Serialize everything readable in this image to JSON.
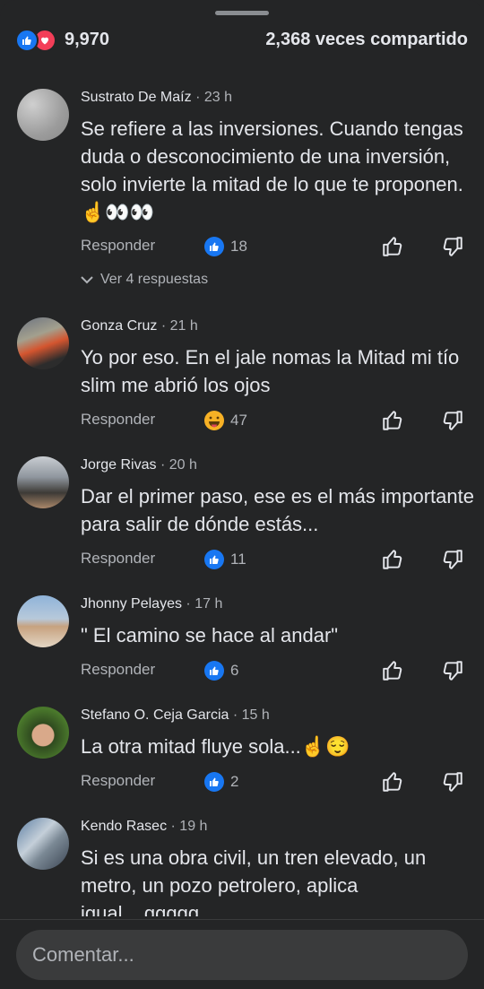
{
  "stats": {
    "reaction_count": "9,970",
    "shares": "2,368 veces compartido"
  },
  "comments": [
    {
      "name": "Sustrato De Maíz",
      "time": "· 23 h",
      "text": "Se refiere a las inversiones. Cuando tengas duda o desconocimiento de una inversión, solo invierte la mitad de lo que te proponen. ☝️👀👀",
      "reply_label": "Responder",
      "reaction": "like",
      "count": "18",
      "replies": "Ver 4 respuestas"
    },
    {
      "name": "Gonza Cruz",
      "time": "· 21 h",
      "text": "Yo por eso. En el jale nomas la Mitad mi tío slim me abrió los ojos",
      "reply_label": "Responder",
      "reaction": "haha",
      "count": "47"
    },
    {
      "name": "Jorge Rivas",
      "time": "· 20 h",
      "text": "Dar el primer paso, ese es el más importante para salir de dónde estás...",
      "reply_label": "Responder",
      "reaction": "like",
      "count": "11"
    },
    {
      "name": "Jhonny Pelayes",
      "time": "· 17 h",
      "text": "\" El camino se hace al andar\"",
      "reply_label": "Responder",
      "reaction": "like",
      "count": "6"
    },
    {
      "name": "Stefano O. Ceja Garcia",
      "time": "· 15 h",
      "text": "La otra mitad fluye sola...☝️😌",
      "reply_label": "Responder",
      "reaction": "like",
      "count": "2"
    },
    {
      "name": "Kendo Rasec",
      "time": "· 19 h",
      "text": "Si es una obra civil, un tren elevado,  un metro, un pozo petrolero, aplica igual....ggggg"
    }
  ],
  "composer": {
    "placeholder": "Comentar..."
  },
  "colors": {
    "background": "#242526",
    "like": "#1877f2",
    "love": "#f33e58",
    "secondary_text": "#b0b3b8",
    "input_bg": "#3a3b3c"
  }
}
